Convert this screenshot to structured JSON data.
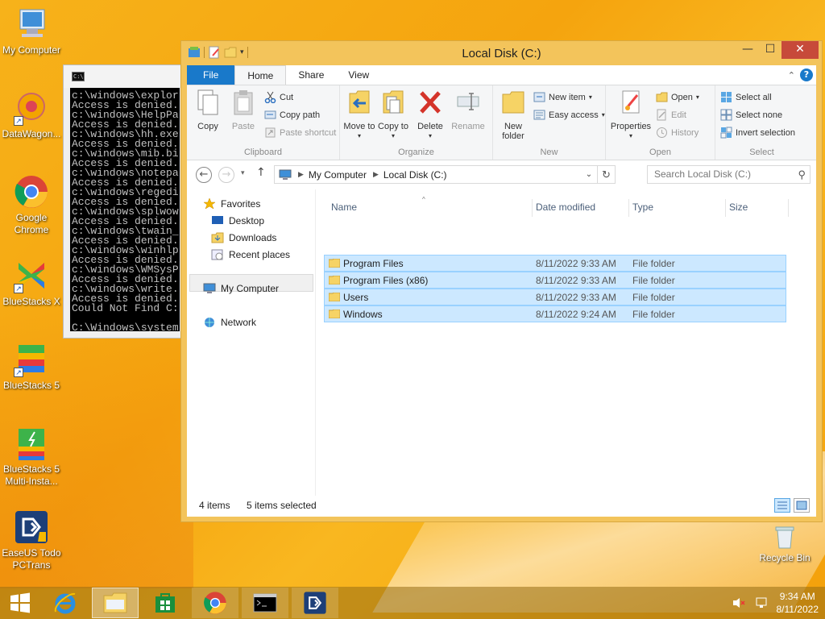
{
  "desktop": {
    "icons": [
      {
        "label": "My Computer"
      },
      {
        "label": "DataWagon..."
      },
      {
        "label": "Google Chrome"
      },
      {
        "label": "BlueStacks X"
      },
      {
        "label": "BlueStacks 5"
      },
      {
        "label": "BlueStacks 5 Multi-Insta..."
      },
      {
        "label": "EaseUS Todo PCTrans"
      },
      {
        "label": "Recycle Bin"
      }
    ]
  },
  "cmd": {
    "lines": [
      "c:\\windows\\explor",
      "Access is denied.",
      "c:\\windows\\HelpPa",
      "Access is denied.",
      "c:\\windows\\hh.exe",
      "Access is denied.",
      "c:\\windows\\mib.bi",
      "Access is denied.",
      "c:\\windows\\notepa",
      "Access is denied.",
      "c:\\windows\\regedi",
      "Access is denied.",
      "c:\\windows\\splwow",
      "Access is denied.",
      "c:\\windows\\twain_",
      "Access is denied.",
      "c:\\windows\\winhlp",
      "Access is denied.",
      "c:\\windows\\WMSysP",
      "Access is denied.",
      "c:\\windows\\write.",
      "Access is denied.",
      "Could Not Find C:",
      "",
      "C:\\Windows\\system"
    ]
  },
  "explorer": {
    "title": "Local Disk (C:)",
    "window_buttons": {
      "minimize": "—",
      "maximize": "☐",
      "close": "✕"
    },
    "tabs": {
      "file": "File",
      "home": "Home",
      "share": "Share",
      "view": "View"
    },
    "help": "?",
    "ribbon": {
      "clipboard": {
        "label": "Clipboard",
        "copy": "Copy",
        "paste": "Paste",
        "cut": "Cut",
        "copy_path": "Copy path",
        "paste_shortcut": "Paste shortcut"
      },
      "organize": {
        "label": "Organize",
        "move_to": "Move to",
        "copy_to": "Copy to",
        "delete": "Delete",
        "rename": "Rename"
      },
      "new": {
        "label": "New",
        "new_folder": "New folder",
        "new_item": "New item",
        "easy_access": "Easy access"
      },
      "open": {
        "label": "Open",
        "properties": "Properties",
        "open": "Open",
        "edit": "Edit",
        "history": "History"
      },
      "select": {
        "label": "Select",
        "select_all": "Select all",
        "select_none": "Select none",
        "invert_selection": "Invert selection"
      }
    },
    "address": {
      "crumbs": [
        "My Computer",
        "Local Disk (C:)"
      ],
      "search_placeholder": "Search Local Disk (C:)"
    },
    "nav": {
      "favorites": "Favorites",
      "desktop": "Desktop",
      "downloads": "Downloads",
      "recent_places": "Recent places",
      "my_computer": "My Computer",
      "network": "Network"
    },
    "columns": {
      "name": "Name",
      "date": "Date modified",
      "type": "Type",
      "size": "Size"
    },
    "files": [
      {
        "name": "Program Files",
        "date": "8/11/2022 9:33 AM",
        "type": "File folder"
      },
      {
        "name": "Program Files (x86)",
        "date": "8/11/2022 9:33 AM",
        "type": "File folder"
      },
      {
        "name": "Users",
        "date": "8/11/2022 9:33 AM",
        "type": "File folder"
      },
      {
        "name": "Windows",
        "date": "8/11/2022 9:24 AM",
        "type": "File folder"
      }
    ],
    "status": {
      "items": "4 items",
      "selected": "5 items selected"
    }
  },
  "taskbar": {
    "time": "9:34 AM",
    "date": "8/11/2022"
  }
}
